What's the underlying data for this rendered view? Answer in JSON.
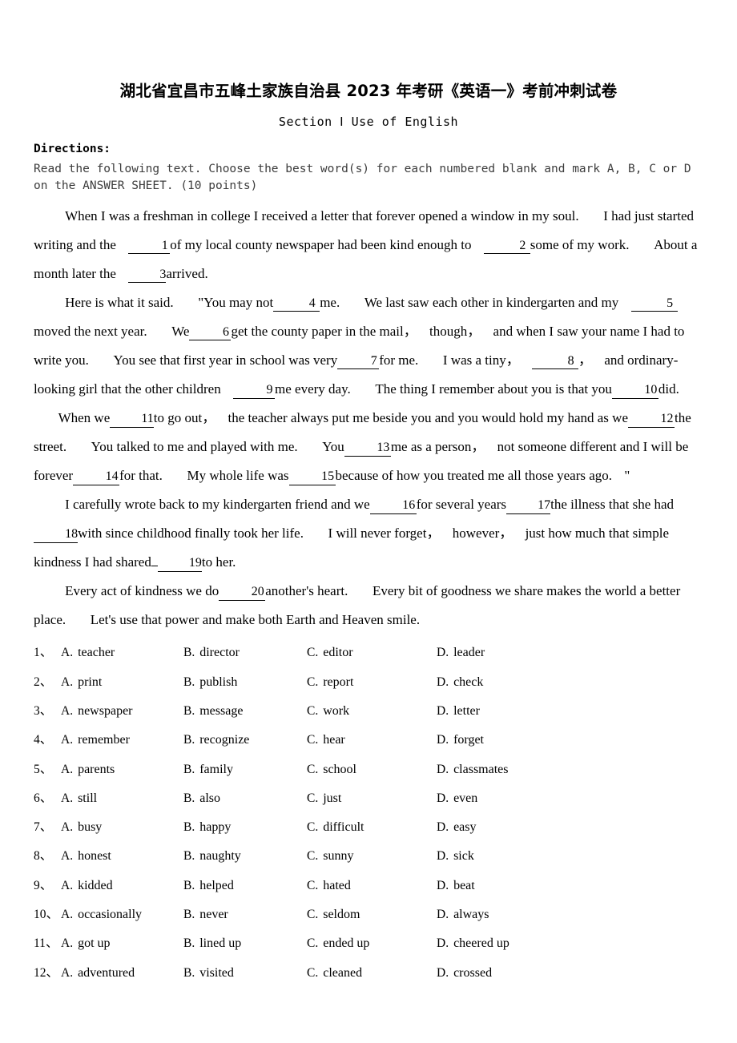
{
  "title": "湖北省宜昌市五峰土家族自治县 2023 年考研《英语一》考前冲刺试卷",
  "section_heading": "Section Ⅰ  Use of  English",
  "directions": {
    "label": "Directions:",
    "body": "Read the following text. Choose the best word(s) for each numbered blank and mark A, B, C or D on the ANSWER SHEET. (10 points)"
  },
  "passage": {
    "p1": {
      "s1": "When I was a freshman in college I received a letter that forever opened a window in my soul.",
      "s2": "I had just started writing and the",
      "b1": "1",
      "s3": "of my local county newspaper had been kind enough to",
      "b2": "2",
      "s4": "some of my work.",
      "s5": "About a month later the",
      "b3": "3",
      "s6": "arrived."
    },
    "p2": {
      "s1": "Here is what it said.",
      "s2": "\"You may not",
      "b4": "4",
      "s3": "me.",
      "s4": "We last saw each other in kindergarten and my",
      "b5": "5",
      "s5": "moved the next year.",
      "s6": "We",
      "b6": "6",
      "s7": "get the county paper in the mail，",
      "s8": "though，",
      "s9": "and when I saw your name I had to write you.",
      "s10": "You see that first year in school was very",
      "b7": "7",
      "s11": "for me.",
      "s12": "I was a tiny，",
      "b8": "8",
      "s13": "，",
      "s14": "and ordinary-looking girl that the other children",
      "b9": "9",
      "s15": "me every day.",
      "s16": "The thing I remember about you is that you",
      "b10": "10",
      "s17": "did.",
      "s18": "When we",
      "b11": "11",
      "s19": "to go out，",
      "s20": "the teacher always put me beside you and you would hold my hand as we",
      "b12": "12",
      "s21": "the street.",
      "s22": "You talked to me and played with me.",
      "s23": "You",
      "b13": "13",
      "s24": "me as a person，",
      "s25": "not someone different and I will be forever",
      "b14": "14",
      "s26": "for that.",
      "s27": "My whole life was",
      "b15": "15",
      "s28": "because of how you treated me all those years ago.",
      "s29": "\""
    },
    "p3": {
      "s1": "I carefully wrote back to my kindergarten friend and we",
      "b16": "16",
      "s2": "for several years",
      "b17": "17",
      "s3": "the illness that she had",
      "b18": "18",
      "s4": "with since childhood finally took her life.",
      "s5": "I will never forget，",
      "s6": "however，",
      "s7": "just how much that simple kindness I had shared",
      "b19": "19",
      "s8": "to her."
    },
    "p4": {
      "s1": "Every act of kindness we do",
      "b20": "20",
      "s2": "another's heart.",
      "s3": "Every bit of goodness we share makes the world a better place.",
      "s4": "Let's use that power and make both Earth and Heaven smile."
    }
  },
  "options": {
    "letters": [
      "A.",
      "B.",
      "C.",
      "D."
    ],
    "separator": "、",
    "items": [
      {
        "num": "1",
        "a": "teacher",
        "b": "director",
        "c": "editor",
        "d": "leader"
      },
      {
        "num": "2",
        "a": "print",
        "b": "publish",
        "c": "report",
        "d": "check"
      },
      {
        "num": "3",
        "a": "newspaper",
        "b": "message",
        "c": "work",
        "d": "letter"
      },
      {
        "num": "4",
        "a": "remember",
        "b": "recognize",
        "c": "hear",
        "d": "forget"
      },
      {
        "num": "5",
        "a": "parents",
        "b": "family",
        "c": "school",
        "d": "classmates"
      },
      {
        "num": "6",
        "a": "still",
        "b": "also",
        "c": "just",
        "d": "even"
      },
      {
        "num": "7",
        "a": "busy",
        "b": "happy",
        "c": "difficult",
        "d": "easy"
      },
      {
        "num": "8",
        "a": "honest",
        "b": "naughty",
        "c": "sunny",
        "d": "sick"
      },
      {
        "num": "9",
        "a": "kidded",
        "b": "helped",
        "c": "hated",
        "d": "beat"
      },
      {
        "num": "10",
        "a": "occasionally",
        "b": "never",
        "c": "seldom",
        "d": "always"
      },
      {
        "num": "11",
        "a": "got up",
        "b": "lined up",
        "c": "ended up",
        "d": "cheered up"
      },
      {
        "num": "12",
        "a": "adventured",
        "b": "visited",
        "c": "cleaned",
        "d": "crossed"
      }
    ]
  }
}
